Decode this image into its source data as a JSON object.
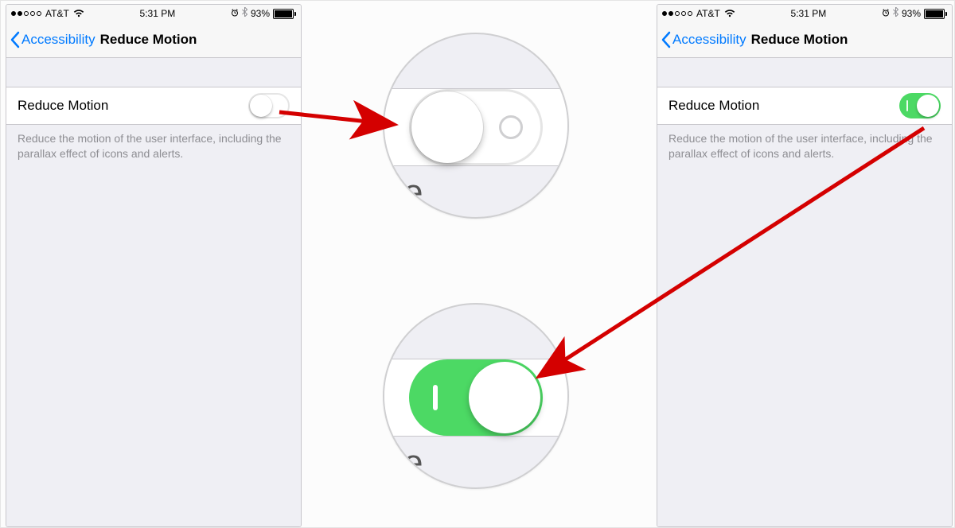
{
  "status": {
    "carrier": "AT&T",
    "time": "5:31 PM",
    "battery": "93%"
  },
  "nav": {
    "back_label": "Accessibility",
    "title": "Reduce Motion"
  },
  "cell": {
    "label": "Reduce Motion"
  },
  "footer": {
    "text": "Reduce the motion of the user interface, including the parallax effect of icons and alerts."
  },
  "left_switch_state": "off",
  "right_switch_state": "on",
  "zoom_peek": "e",
  "colors": {
    "ios_blue": "#007aff",
    "ios_green": "#4cd964"
  }
}
